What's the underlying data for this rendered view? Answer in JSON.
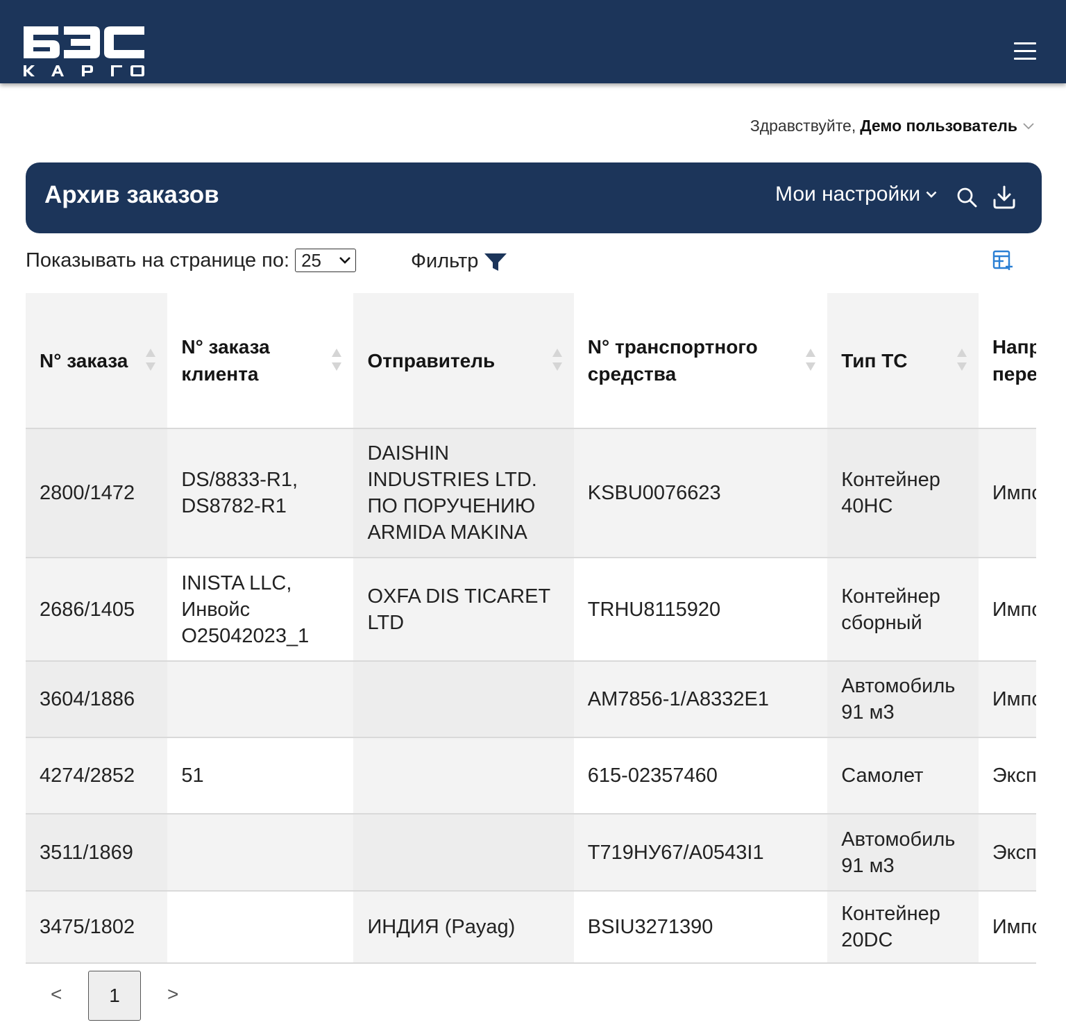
{
  "header": {
    "logo_main": "БЭС",
    "logo_sub": "КАРГО",
    "menu_icon": "hamburger-icon"
  },
  "greeting": {
    "prefix": "Здравствуйте,",
    "user": "Демо пользователь"
  },
  "panel": {
    "title": "Архив заказов",
    "settings_label": "Мои настройки",
    "search_icon": "search-icon",
    "download_icon": "download-icon"
  },
  "controls": {
    "perpage_label": "Показывать на странице по:",
    "perpage_value": "25",
    "filter_label": "Фильтр",
    "columns_icon": "table-columns-icon"
  },
  "table": {
    "headers": [
      "N° заказа",
      "N° заказа клиента",
      "Отправитель",
      "N° транспортного средства",
      "Тип ТС",
      "Направление перевозки"
    ],
    "rows": [
      [
        "2800/1472",
        "DS/8833-R1, DS8782-R1",
        "DAISHIN INDUSTRIES LTD. ПО ПОРУЧЕНИЮ ARMIDA MAKINA",
        "KSBU0076623",
        "Контейнер 40HC",
        "Импорт"
      ],
      [
        "2686/1405",
        "INISTA LLC, Инвойс O25042023_1",
        "OXFA DIS TICARET LTD",
        "TRHU8115920",
        "Контейнер сборный",
        "Импорт"
      ],
      [
        "3604/1886",
        "",
        "",
        "AM7856-1/A8332E1",
        "Автомобиль 91 м3",
        "Импорт"
      ],
      [
        "4274/2852",
        "51",
        "",
        "615-02357460",
        "Самолет",
        "Экспорт"
      ],
      [
        "3511/1869",
        "",
        "",
        "T719HУ67/A0543I1",
        "Автомобиль 91 м3",
        "Экспорт"
      ],
      [
        "3475/1802",
        "",
        "ИНДИЯ (Payag)",
        "BSIU3271390",
        "Контейнер 20DC",
        "Импорт"
      ]
    ]
  },
  "pagination": {
    "prev": "<",
    "current": "1",
    "next": ">"
  },
  "colors": {
    "brand_navy": "#1c355a",
    "accent_blue": "#2a7fd4"
  }
}
